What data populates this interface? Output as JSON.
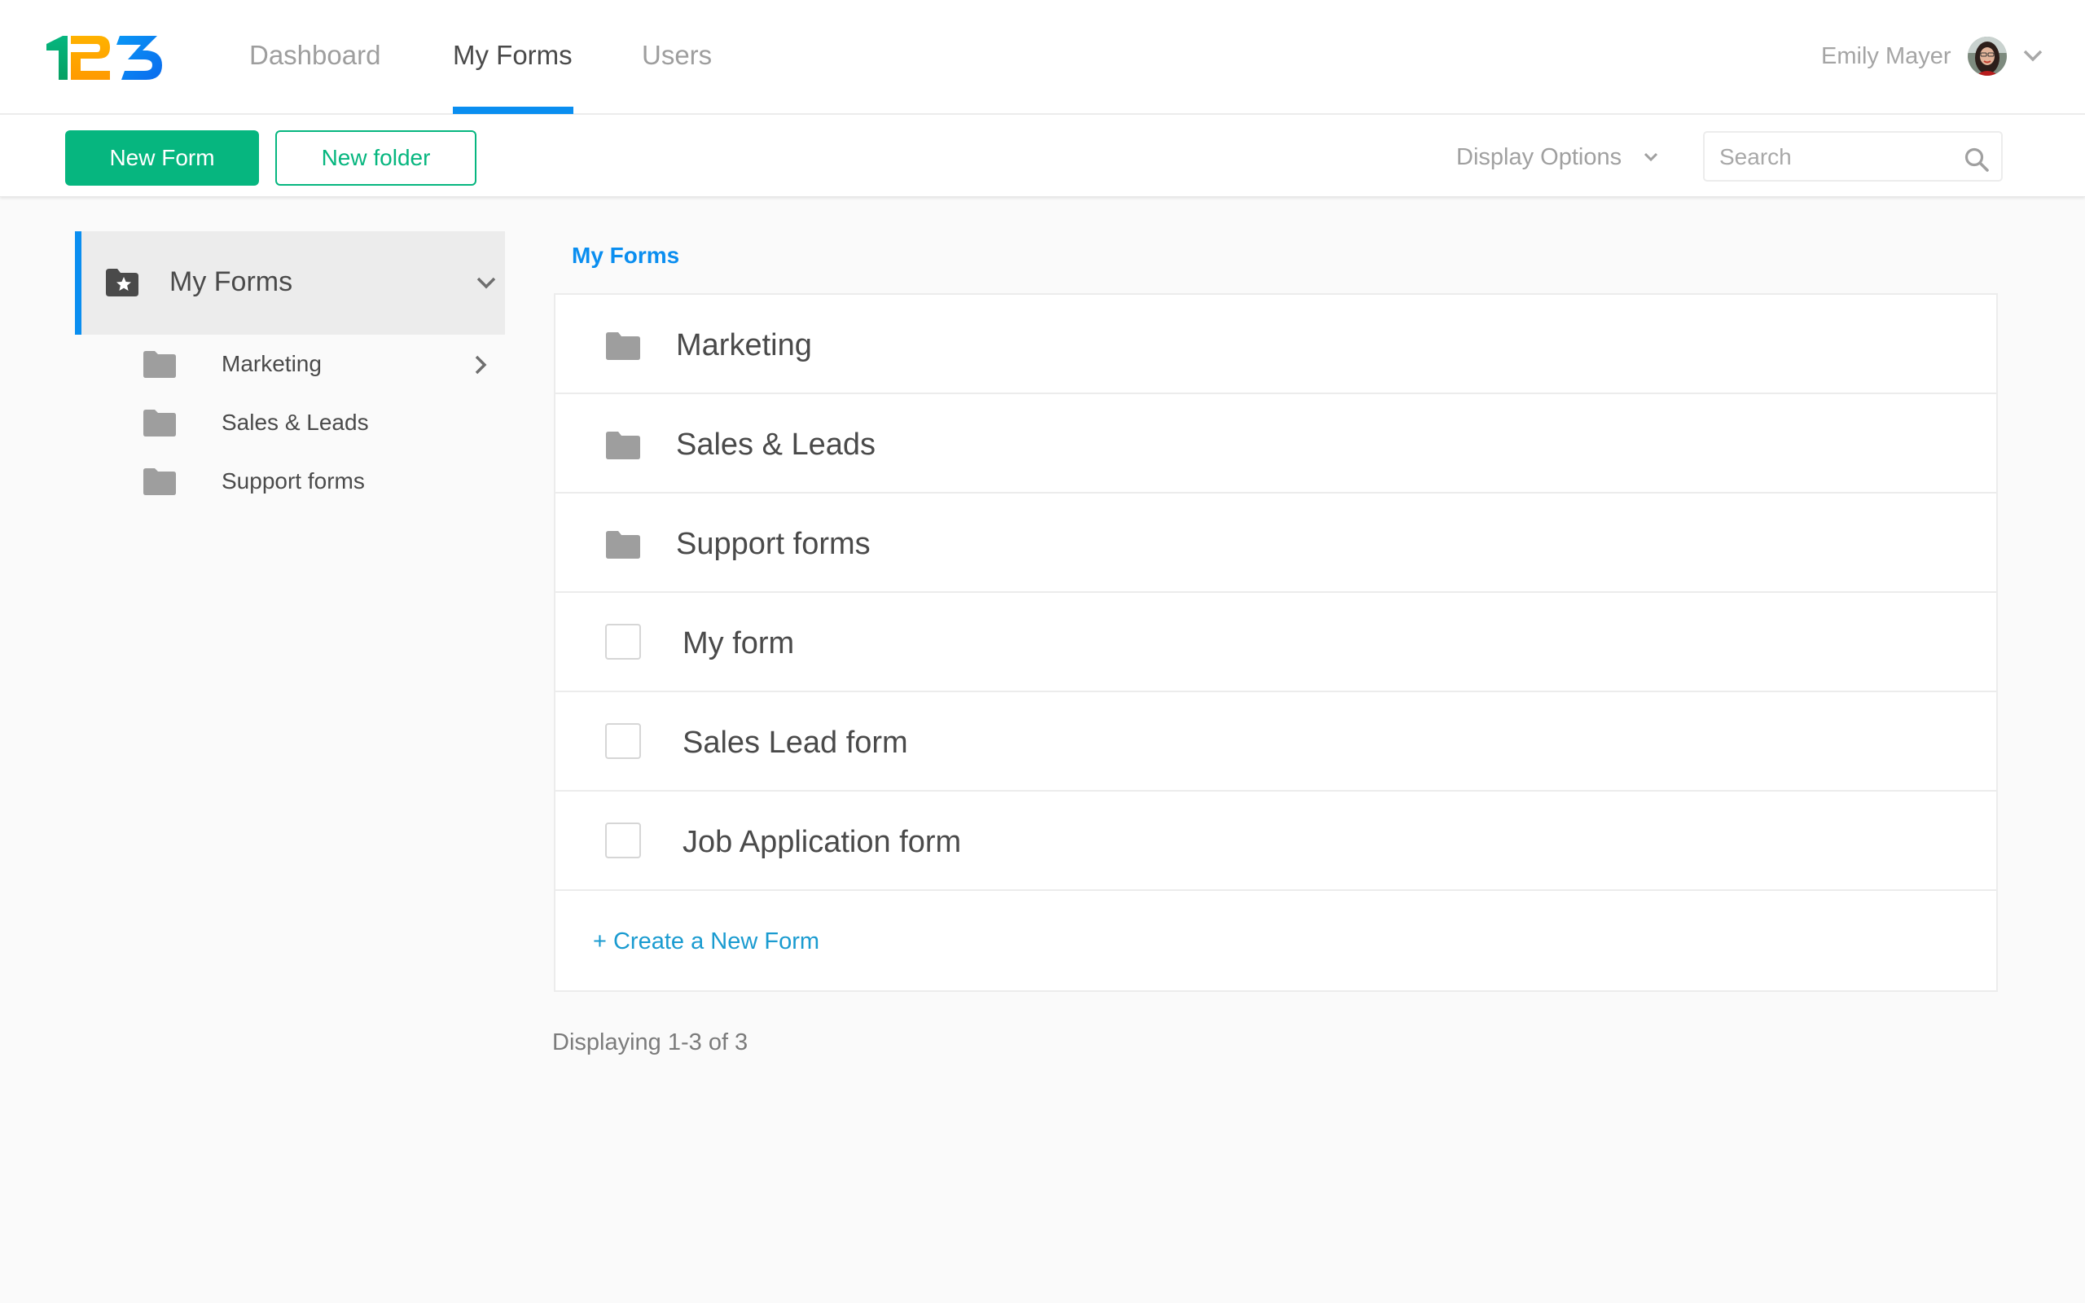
{
  "brand": {
    "logo_text": "123",
    "colors": {
      "one": "#05a86d",
      "two": "#ffa800",
      "three": "#0a7ef0"
    }
  },
  "header": {
    "nav": [
      {
        "label": "Dashboard",
        "active": false
      },
      {
        "label": "My Forms",
        "active": true
      },
      {
        "label": "Users",
        "active": false
      }
    ],
    "user": {
      "name": "Emily Mayer",
      "avatar_icon": "user-avatar"
    }
  },
  "toolbar": {
    "new_form_label": "New Form",
    "new_folder_label": "New folder",
    "display_options_label": "Display Options",
    "search": {
      "placeholder": "Search",
      "value": ""
    }
  },
  "sidebar": {
    "root": {
      "label": "My Forms",
      "icon": "star-folder-icon",
      "expanded": true
    },
    "folders": [
      {
        "label": "Marketing",
        "has_children": true
      },
      {
        "label": "Sales & Leads",
        "has_children": false
      },
      {
        "label": "Support forms",
        "has_children": false
      }
    ]
  },
  "main": {
    "breadcrumb": "My Forms",
    "folders": [
      {
        "label": "Marketing"
      },
      {
        "label": "Sales & Leads"
      },
      {
        "label": "Support forms"
      }
    ],
    "forms": [
      {
        "label": "My form",
        "checked": false
      },
      {
        "label": "Sales Lead form",
        "checked": false
      },
      {
        "label": "Job Application form",
        "checked": false
      }
    ],
    "create_link": "+ Create a New Form",
    "count_text": "Displaying 1-3 of 3"
  },
  "theme": {
    "accent_blue": "#0a8ef0",
    "accent_green": "#06b67f",
    "link_blue": "#1a9bd0"
  }
}
